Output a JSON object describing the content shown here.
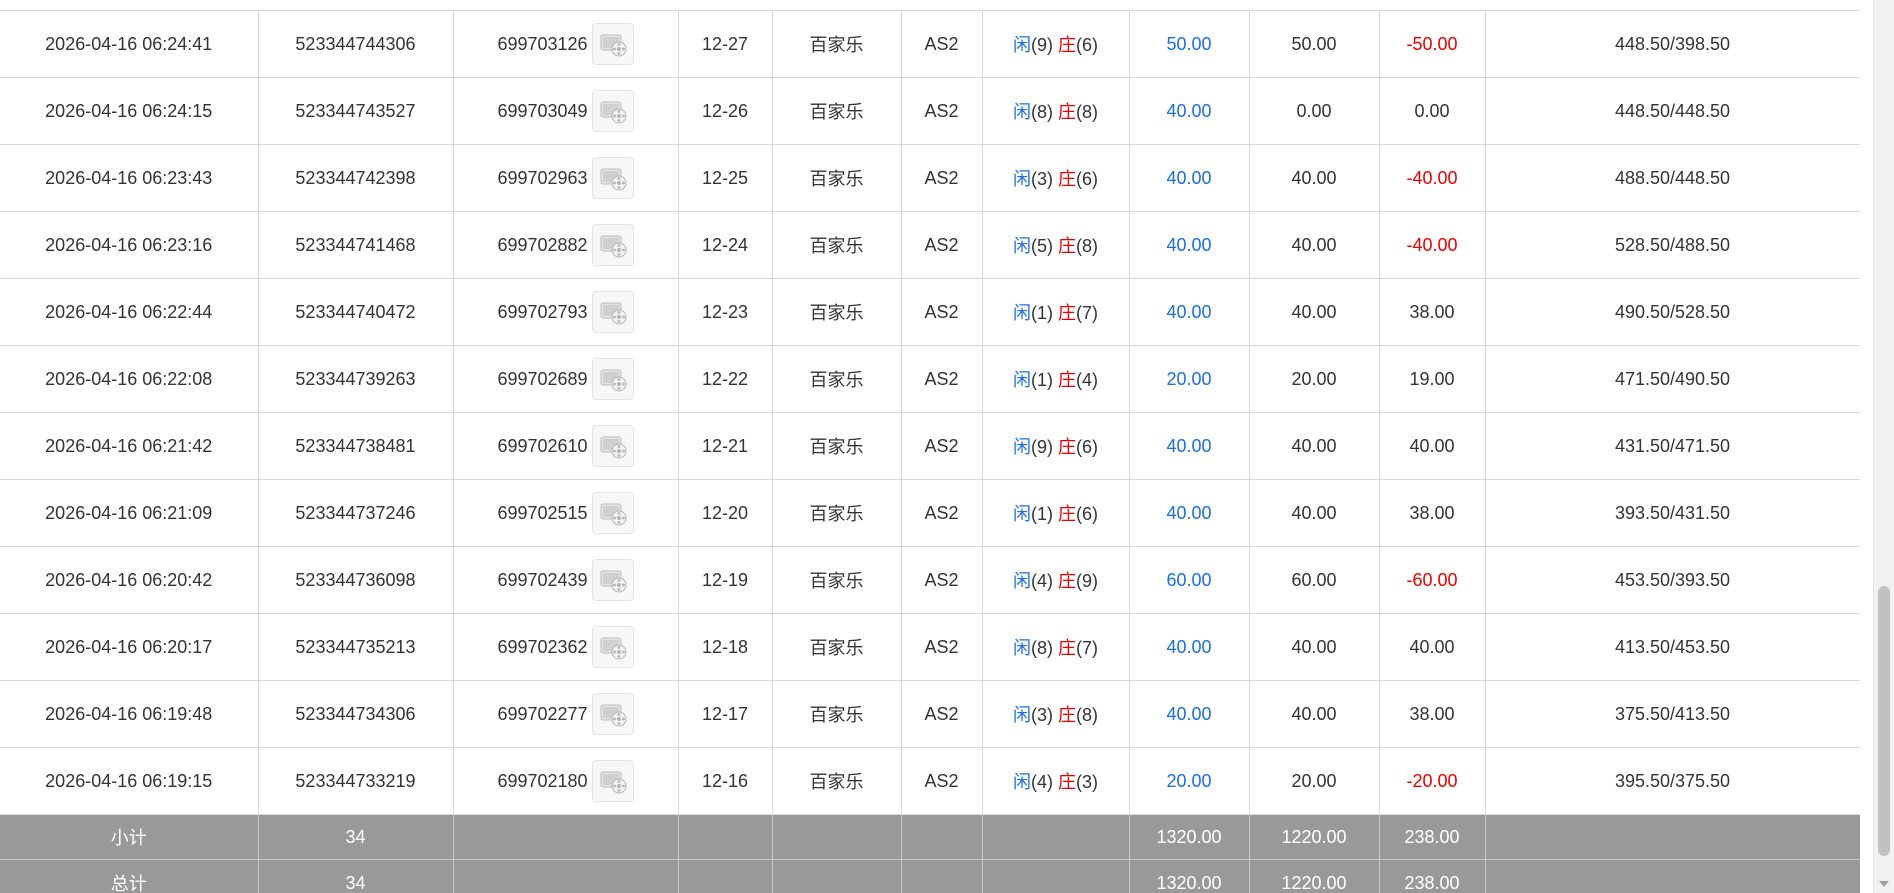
{
  "rows": [
    {
      "time": "2026-04-16 06:24:41",
      "order_no": "523344744306",
      "bet_id": "699703126",
      "round": "12-27",
      "game": "百家乐",
      "table": "AS2",
      "player_label": "闲",
      "player_score": "(9)",
      "banker_label": "庄",
      "banker_score": "(6)",
      "bet_amount": "50.00",
      "valid_bet": "50.00",
      "win_loss": "-50.00",
      "win_loss_negative": true,
      "balance": "448.50/398.50"
    },
    {
      "time": "2026-04-16 06:24:15",
      "order_no": "523344743527",
      "bet_id": "699703049",
      "round": "12-26",
      "game": "百家乐",
      "table": "AS2",
      "player_label": "闲",
      "player_score": "(8)",
      "banker_label": "庄",
      "banker_score": "(8)",
      "bet_amount": "40.00",
      "valid_bet": "0.00",
      "win_loss": "0.00",
      "win_loss_negative": false,
      "balance": "448.50/448.50"
    },
    {
      "time": "2026-04-16 06:23:43",
      "order_no": "523344742398",
      "bet_id": "699702963",
      "round": "12-25",
      "game": "百家乐",
      "table": "AS2",
      "player_label": "闲",
      "player_score": "(3)",
      "banker_label": "庄",
      "banker_score": "(6)",
      "bet_amount": "40.00",
      "valid_bet": "40.00",
      "win_loss": "-40.00",
      "win_loss_negative": true,
      "balance": "488.50/448.50"
    },
    {
      "time": "2026-04-16 06:23:16",
      "order_no": "523344741468",
      "bet_id": "699702882",
      "round": "12-24",
      "game": "百家乐",
      "table": "AS2",
      "player_label": "闲",
      "player_score": "(5)",
      "banker_label": "庄",
      "banker_score": "(8)",
      "bet_amount": "40.00",
      "valid_bet": "40.00",
      "win_loss": "-40.00",
      "win_loss_negative": true,
      "balance": "528.50/488.50"
    },
    {
      "time": "2026-04-16 06:22:44",
      "order_no": "523344740472",
      "bet_id": "699702793",
      "round": "12-23",
      "game": "百家乐",
      "table": "AS2",
      "player_label": "闲",
      "player_score": "(1)",
      "banker_label": "庄",
      "banker_score": "(7)",
      "bet_amount": "40.00",
      "valid_bet": "40.00",
      "win_loss": "38.00",
      "win_loss_negative": false,
      "balance": "490.50/528.50"
    },
    {
      "time": "2026-04-16 06:22:08",
      "order_no": "523344739263",
      "bet_id": "699702689",
      "round": "12-22",
      "game": "百家乐",
      "table": "AS2",
      "player_label": "闲",
      "player_score": "(1)",
      "banker_label": "庄",
      "banker_score": "(4)",
      "bet_amount": "20.00",
      "valid_bet": "20.00",
      "win_loss": "19.00",
      "win_loss_negative": false,
      "balance": "471.50/490.50"
    },
    {
      "time": "2026-04-16 06:21:42",
      "order_no": "523344738481",
      "bet_id": "699702610",
      "round": "12-21",
      "game": "百家乐",
      "table": "AS2",
      "player_label": "闲",
      "player_score": "(9)",
      "banker_label": "庄",
      "banker_score": "(6)",
      "bet_amount": "40.00",
      "valid_bet": "40.00",
      "win_loss": "40.00",
      "win_loss_negative": false,
      "balance": "431.50/471.50"
    },
    {
      "time": "2026-04-16 06:21:09",
      "order_no": "523344737246",
      "bet_id": "699702515",
      "round": "12-20",
      "game": "百家乐",
      "table": "AS2",
      "player_label": "闲",
      "player_score": "(1)",
      "banker_label": "庄",
      "banker_score": "(6)",
      "bet_amount": "40.00",
      "valid_bet": "40.00",
      "win_loss": "38.00",
      "win_loss_negative": false,
      "balance": "393.50/431.50"
    },
    {
      "time": "2026-04-16 06:20:42",
      "order_no": "523344736098",
      "bet_id": "699702439",
      "round": "12-19",
      "game": "百家乐",
      "table": "AS2",
      "player_label": "闲",
      "player_score": "(4)",
      "banker_label": "庄",
      "banker_score": "(9)",
      "bet_amount": "60.00",
      "valid_bet": "60.00",
      "win_loss": "-60.00",
      "win_loss_negative": true,
      "balance": "453.50/393.50"
    },
    {
      "time": "2026-04-16 06:20:17",
      "order_no": "523344735213",
      "bet_id": "699702362",
      "round": "12-18",
      "game": "百家乐",
      "table": "AS2",
      "player_label": "闲",
      "player_score": "(8)",
      "banker_label": "庄",
      "banker_score": "(7)",
      "bet_amount": "40.00",
      "valid_bet": "40.00",
      "win_loss": "40.00",
      "win_loss_negative": false,
      "balance": "413.50/453.50"
    },
    {
      "time": "2026-04-16 06:19:48",
      "order_no": "523344734306",
      "bet_id": "699702277",
      "round": "12-17",
      "game": "百家乐",
      "table": "AS2",
      "player_label": "闲",
      "player_score": "(3)",
      "banker_label": "庄",
      "banker_score": "(8)",
      "bet_amount": "40.00",
      "valid_bet": "40.00",
      "win_loss": "38.00",
      "win_loss_negative": false,
      "balance": "375.50/413.50"
    },
    {
      "time": "2026-04-16 06:19:15",
      "order_no": "523344733219",
      "bet_id": "699702180",
      "round": "12-16",
      "game": "百家乐",
      "table": "AS2",
      "player_label": "闲",
      "player_score": "(4)",
      "banker_label": "庄",
      "banker_score": "(3)",
      "bet_amount": "20.00",
      "valid_bet": "20.00",
      "win_loss": "-20.00",
      "win_loss_negative": true,
      "balance": "395.50/375.50"
    }
  ],
  "subtotal": {
    "label": "小计",
    "count": "34",
    "bet_amount": "1320.00",
    "valid_bet": "1220.00",
    "win_loss": "238.00"
  },
  "total": {
    "label": "总计",
    "count": "34",
    "bet_amount": "1320.00",
    "valid_bet": "1220.00",
    "win_loss": "238.00"
  },
  "icons": {
    "video": "video-replay-icon"
  },
  "colors": {
    "player": "#1a6fe0",
    "banker": "#e60000",
    "negative": "#e60000",
    "bet_amount": "#1a6fe0",
    "total_bg": "#999999"
  }
}
